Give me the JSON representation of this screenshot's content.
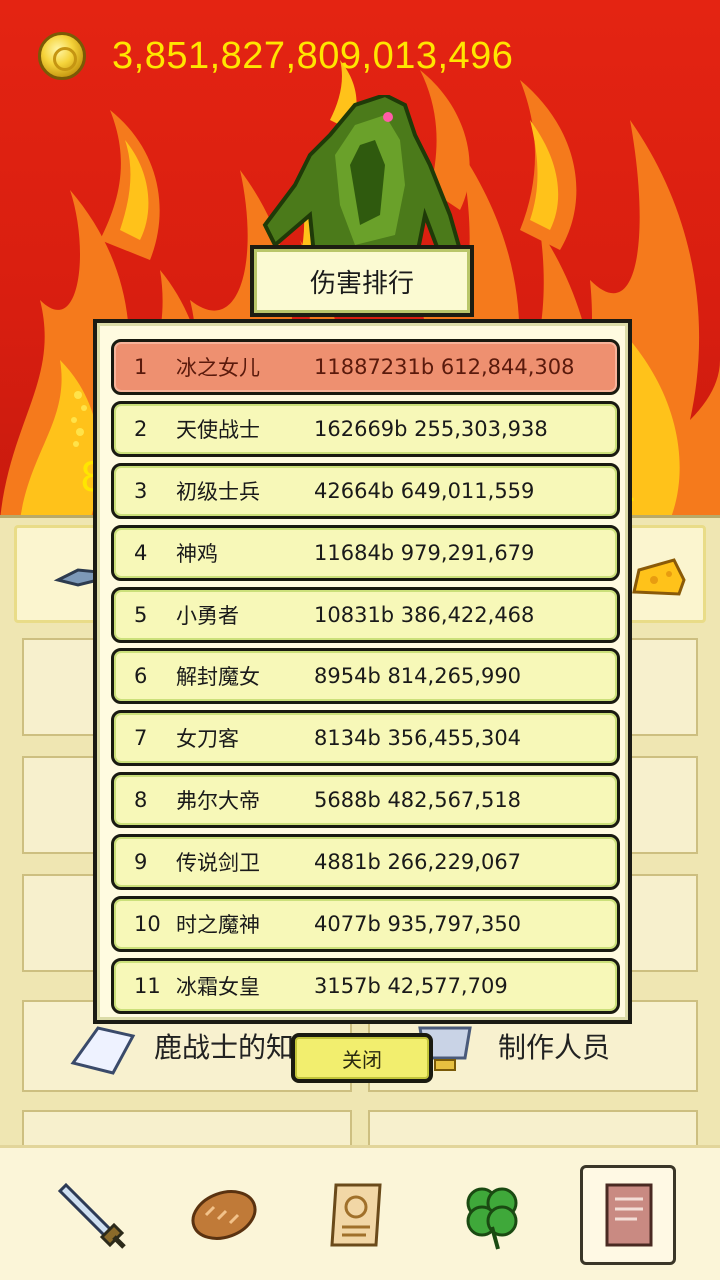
{
  "header": {
    "coin_icon": "gold-coin-icon",
    "coins": "3,851,827,809,013,496"
  },
  "background": {
    "partial_text_left": "8",
    "partial_text_right": "."
  },
  "modal": {
    "title": "伤害排行",
    "close_label": "关闭",
    "rows": [
      {
        "rank": "1",
        "name": "冰之女儿",
        "damage": "11887231b 612,844,308"
      },
      {
        "rank": "2",
        "name": "天使战士",
        "damage": "162669b 255,303,938"
      },
      {
        "rank": "3",
        "name": "初级士兵",
        "damage": "42664b 649,011,559"
      },
      {
        "rank": "4",
        "name": "神鸡",
        "damage": "11684b 979,291,679"
      },
      {
        "rank": "5",
        "name": "小勇者",
        "damage": "10831b 386,422,468"
      },
      {
        "rank": "6",
        "name": "解封魔女",
        "damage": "8954b 814,265,990"
      },
      {
        "rank": "7",
        "name": "女刀客",
        "damage": "8134b 356,455,304"
      },
      {
        "rank": "8",
        "name": "弗尔大帝",
        "damage": "5688b 482,567,518"
      },
      {
        "rank": "9",
        "name": "传说剑卫",
        "damage": "4881b 266,229,067"
      },
      {
        "rank": "10",
        "name": "时之魔神",
        "damage": "4077b 935,797,350"
      },
      {
        "rank": "11",
        "name": "冰霜女皇",
        "damage": "3157b 42,577,709"
      }
    ]
  },
  "menu": {
    "knowledge_label": "鹿战士的知识",
    "credits_label": "制作人员"
  },
  "nav": {
    "items": [
      {
        "icon": "sword-icon"
      },
      {
        "icon": "bread-icon"
      },
      {
        "icon": "scroll-icon"
      },
      {
        "icon": "clover-icon"
      },
      {
        "icon": "book-icon"
      }
    ]
  }
}
